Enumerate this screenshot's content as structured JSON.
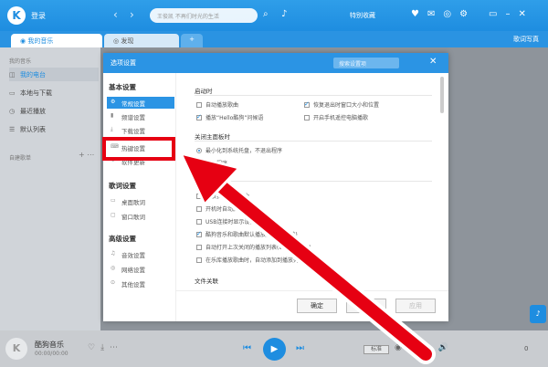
{
  "titlebar": {
    "login": "登录",
    "search_placeholder": "王俊凯 不再们时光的生活",
    "skin": "特别收藏"
  },
  "tabs": {
    "music": "我的音乐",
    "discover": "发现",
    "add": "+",
    "lyric": "歌词写真"
  },
  "sidebar": {
    "section_title": "我的音乐",
    "items": [
      {
        "icon": "radio-icon",
        "label": "我的电台"
      },
      {
        "icon": "download-icon",
        "label": "本地与下载"
      },
      {
        "icon": "clock-icon",
        "label": "最近播放"
      },
      {
        "icon": "list-icon",
        "label": "默认列表"
      }
    ],
    "playlist_title": "自建歌单"
  },
  "player": {
    "title": "酷狗音乐",
    "time": "00:00/00:00",
    "quality": "标准",
    "count": "0"
  },
  "dialog": {
    "title": "选项设置",
    "search_placeholder": "搜索设置项",
    "nav": {
      "basic_title": "基本设置",
      "basic_items": [
        {
          "icon": "settings-icon",
          "label": "常规设置"
        },
        {
          "icon": "bars-icon",
          "label": "频谱设置"
        },
        {
          "icon": "download-icon",
          "label": "下载设置"
        },
        {
          "icon": "keyboard-icon",
          "label": "热键设置"
        },
        {
          "icon": "update-icon",
          "label": "软件更新"
        }
      ],
      "lyric_title": "歌词设置",
      "lyric_items": [
        {
          "icon": "desktop-icon",
          "label": "桌面歌词"
        },
        {
          "icon": "window-icon",
          "label": "窗口歌词"
        }
      ],
      "advanced_title": "高级设置",
      "advanced_items": [
        {
          "icon": "volume-icon",
          "label": "音效设置"
        },
        {
          "icon": "network-icon",
          "label": "网络设置"
        },
        {
          "icon": "other-icon",
          "label": "其他设置"
        }
      ]
    },
    "startup": {
      "title": "启动时",
      "opt1": "自动播放歌曲",
      "opt2": "恢复退出时窗口大小和位置",
      "opt3": "播放“Hello酷狗”问候语",
      "opt4": "开启手机遥控电脑播歌"
    },
    "close": {
      "title": "关闭主面板时",
      "opt1": "最小化到系统托盘，不退出程序",
      "opt2": "退出程序"
    },
    "other": {
      "opt1": "播放我喜欢的歌曲",
      "opt2": "开机时自动启动",
      "opt3": "USB连接时显示设备接入提示",
      "opt4": "酷狗音乐和歌曲默认播放器(音乐播放)",
      "opt5": "自动打开上次关闭的播放列表(Win10 有效)",
      "opt6": "在乐库播放歌曲时，自动添加到播放列表"
    },
    "file_title": "文件关联",
    "buttons": {
      "ok": "确定",
      "cancel": "取消",
      "apply": "应用"
    }
  },
  "colors": {
    "accent": "#2b94e4",
    "highlight": "#e60012"
  }
}
